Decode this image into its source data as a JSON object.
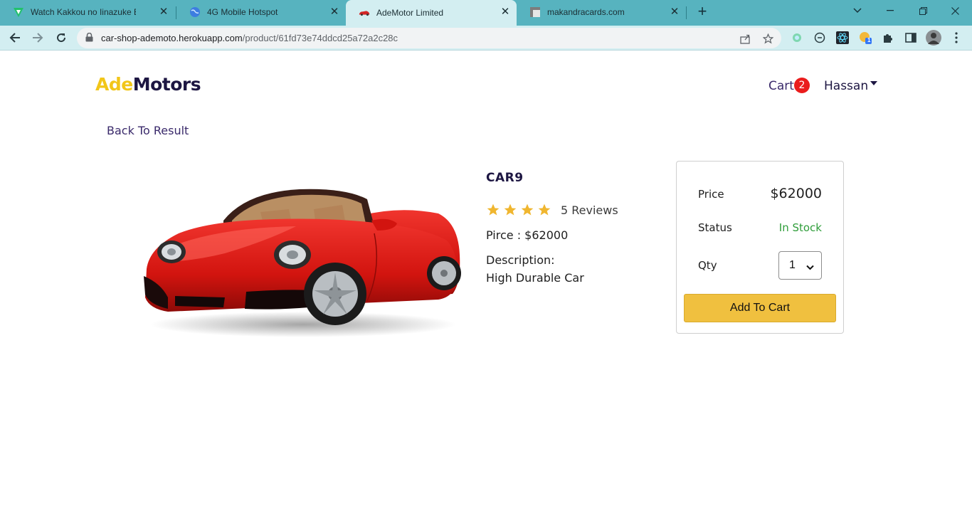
{
  "browser": {
    "tabs": [
      {
        "title": "Watch Kakkou no Iinazuke Episo",
        "favicon": "tv-icon",
        "active": false
      },
      {
        "title": "4G Mobile Hotspot",
        "favicon": "globe-icon",
        "active": false
      },
      {
        "title": "AdeMotor Limited",
        "favicon": "car-icon",
        "active": true
      },
      {
        "title": "makandracards.com",
        "favicon": "page-icon",
        "active": false
      }
    ],
    "new_tab_label": "+",
    "url_host": "car-shop-ademoto.herokuapp.com",
    "url_path": "/product/61fd73e74ddcd25a72a2c28c",
    "extension_badge": "1"
  },
  "site": {
    "brand_part1": "Ade",
    "brand_part2": "Motors",
    "brand_colors": {
      "ade": "#f2c619",
      "motors": "#1d1642"
    },
    "cart_label": "Cart",
    "cart_count": "2",
    "user_name": "Hassan"
  },
  "product": {
    "back_link": "Back To Result",
    "name": "CAR9",
    "rating": 4,
    "reviews": "5 Reviews",
    "price_line": "Pirce : $62000",
    "description_label": "Description:",
    "description": "High Durable Car",
    "image": "red-convertible-car"
  },
  "buy_panel": {
    "price_label": "Price",
    "price_value": "$62000",
    "status_label": "Status",
    "status_value": "In Stock",
    "status_color": "#2f9d3a",
    "qty_label": "Qty",
    "qty_value": "1",
    "add_button": "Add To Cart",
    "button_color": "#f0c03f"
  }
}
